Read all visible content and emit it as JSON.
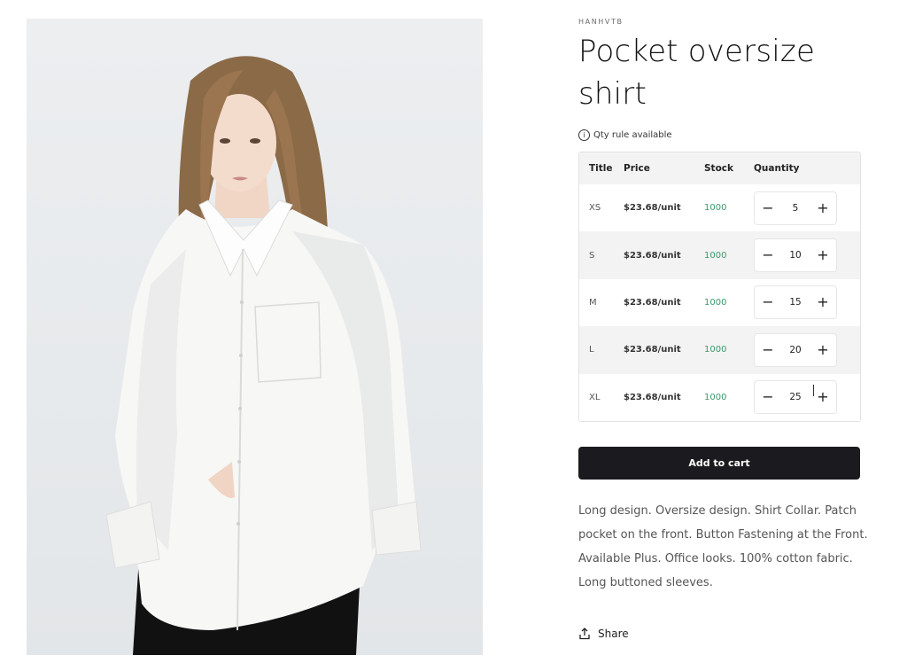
{
  "product": {
    "vendor": "HANHVTB",
    "title": "Pocket oversize shirt",
    "qty_rule_label": "Qty rule available",
    "add_to_cart_label": "Add to cart",
    "description": "Long design. Oversize design. Shirt Collar. Patch pocket on the front. Button Fastening at the Front. Available Plus. Office looks. 100% cotton fabric. Long buttoned sleeves.",
    "share_label": "Share"
  },
  "table": {
    "headers": {
      "title": "Title",
      "price": "Price",
      "stock": "Stock",
      "quantity": "Quantity"
    },
    "rows": [
      {
        "title": "XS",
        "price": "$23.68/unit",
        "stock": "1000",
        "quantity": "5"
      },
      {
        "title": "S",
        "price": "$23.68/unit",
        "stock": "1000",
        "quantity": "10"
      },
      {
        "title": "M",
        "price": "$23.68/unit",
        "stock": "1000",
        "quantity": "15"
      },
      {
        "title": "L",
        "price": "$23.68/unit",
        "stock": "1000",
        "quantity": "20"
      },
      {
        "title": "XL",
        "price": "$23.68/unit",
        "stock": "1000",
        "quantity": "25"
      }
    ],
    "minus_symbol": "−",
    "plus_symbol": "+"
  },
  "icons": {
    "info": "info-icon",
    "share": "share-icon",
    "minus": "minus-icon",
    "plus": "plus-icon"
  },
  "colors": {
    "stock_text": "#3a9a6a",
    "cart_button": "#1b1b1f"
  }
}
